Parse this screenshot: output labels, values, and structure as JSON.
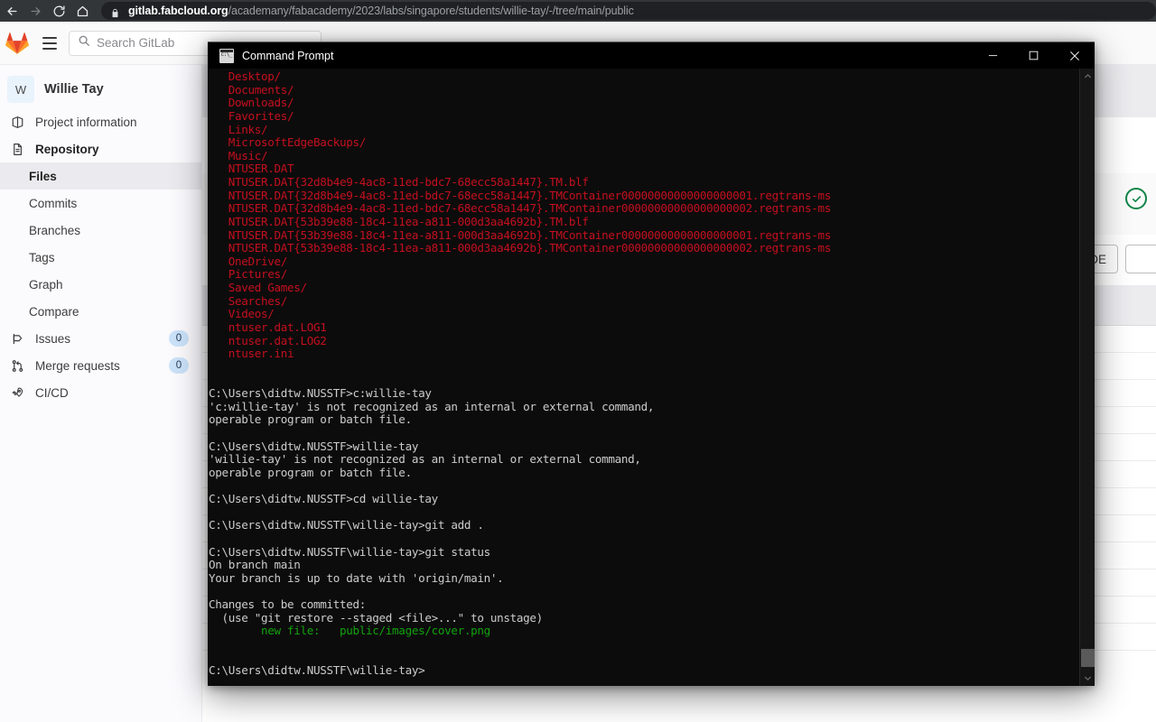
{
  "browser": {
    "back_icon": "arrow-left-icon",
    "forward_icon": "arrow-right-icon",
    "reload_icon": "reload-icon",
    "home_icon": "home-icon",
    "lock_icon": "lock-icon",
    "url_domain": "gitlab.fabcloud.org",
    "url_path": "/academany/fabacademy/2023/labs/singapore/students/willie-tay/-/tree/main/public"
  },
  "topbar": {
    "logo": "gitlab-logo-icon",
    "menu_icon": "hamburger-menu-icon",
    "search_icon": "search-icon",
    "search_placeholder": "Search GitLab",
    "search_value": ""
  },
  "sidebar": {
    "project_initial": "W",
    "project_name": "Willie Tay",
    "items": [
      {
        "label": "Project information",
        "icon": "project-info-icon",
        "badge": ""
      },
      {
        "label": "Repository",
        "icon": "repository-icon",
        "badge": ""
      }
    ],
    "repository_children": [
      {
        "label": "Files",
        "active": true
      },
      {
        "label": "Commits",
        "active": false
      },
      {
        "label": "Branches",
        "active": false
      },
      {
        "label": "Tags",
        "active": false
      },
      {
        "label": "Graph",
        "active": false
      },
      {
        "label": "Compare",
        "active": false
      }
    ],
    "lower_items": [
      {
        "label": "Issues",
        "icon": "issues-icon",
        "badge": "0"
      },
      {
        "label": "Merge requests",
        "icon": "merge-request-icon",
        "badge": "0"
      },
      {
        "label": "CI/CD",
        "icon": "rocket-icon",
        "badge": ""
      }
    ]
  },
  "main": {
    "pipeline_status_icon": "pipeline-success-check-icon",
    "web_ide_label": "Web IDE",
    "file_row_count": 12
  },
  "cmd": {
    "app_icon": "command-prompt-icon",
    "title": "Command Prompt",
    "minimize_icon": "minimize-icon",
    "maximize_icon": "maximize-icon",
    "close_icon": "close-icon",
    "scroll_up_icon": "chevron-up-icon",
    "scroll_down_icon": "chevron-down-icon",
    "lines": [
      {
        "color": "red",
        "text": "   Desktop/"
      },
      {
        "color": "red",
        "text": "   Documents/"
      },
      {
        "color": "red",
        "text": "   Downloads/"
      },
      {
        "color": "red",
        "text": "   Favorites/"
      },
      {
        "color": "red",
        "text": "   Links/"
      },
      {
        "color": "red",
        "text": "   MicrosoftEdgeBackups/"
      },
      {
        "color": "red",
        "text": "   Music/"
      },
      {
        "color": "red",
        "text": "   NTUSER.DAT"
      },
      {
        "color": "red",
        "text": "   NTUSER.DAT{32d8b4e9-4ac8-11ed-bdc7-68ecc58a1447}.TM.blf"
      },
      {
        "color": "red",
        "text": "   NTUSER.DAT{32d8b4e9-4ac8-11ed-bdc7-68ecc58a1447}.TMContainer00000000000000000001.regtrans-ms"
      },
      {
        "color": "red",
        "text": "   NTUSER.DAT{32d8b4e9-4ac8-11ed-bdc7-68ecc58a1447}.TMContainer00000000000000000002.regtrans-ms"
      },
      {
        "color": "red",
        "text": "   NTUSER.DAT{53b39e88-18c4-11ea-a811-000d3aa4692b}.TM.blf"
      },
      {
        "color": "red",
        "text": "   NTUSER.DAT{53b39e88-18c4-11ea-a811-000d3aa4692b}.TMContainer00000000000000000001.regtrans-ms"
      },
      {
        "color": "red",
        "text": "   NTUSER.DAT{53b39e88-18c4-11ea-a811-000d3aa4692b}.TMContainer00000000000000000002.regtrans-ms"
      },
      {
        "color": "red",
        "text": "   OneDrive/"
      },
      {
        "color": "red",
        "text": "   Pictures/"
      },
      {
        "color": "red",
        "text": "   Saved Games/"
      },
      {
        "color": "red",
        "text": "   Searches/"
      },
      {
        "color": "red",
        "text": "   Videos/"
      },
      {
        "color": "red",
        "text": "   ntuser.dat.LOG1"
      },
      {
        "color": "red",
        "text": "   ntuser.dat.LOG2"
      },
      {
        "color": "red",
        "text": "   ntuser.ini"
      },
      {
        "color": "wht",
        "text": ""
      },
      {
        "color": "wht",
        "text": ""
      },
      {
        "color": "wht",
        "text": "C:\\Users\\didtw.NUSSTF>c:willie-tay"
      },
      {
        "color": "wht",
        "text": "'c:willie-tay' is not recognized as an internal or external command,"
      },
      {
        "color": "wht",
        "text": "operable program or batch file."
      },
      {
        "color": "wht",
        "text": ""
      },
      {
        "color": "wht",
        "text": "C:\\Users\\didtw.NUSSTF>willie-tay"
      },
      {
        "color": "wht",
        "text": "'willie-tay' is not recognized as an internal or external command,"
      },
      {
        "color": "wht",
        "text": "operable program or batch file."
      },
      {
        "color": "wht",
        "text": ""
      },
      {
        "color": "wht",
        "text": "C:\\Users\\didtw.NUSSTF>cd willie-tay"
      },
      {
        "color": "wht",
        "text": ""
      },
      {
        "color": "wht",
        "text": "C:\\Users\\didtw.NUSSTF\\willie-tay>git add ."
      },
      {
        "color": "wht",
        "text": ""
      },
      {
        "color": "wht",
        "text": "C:\\Users\\didtw.NUSSTF\\willie-tay>git status"
      },
      {
        "color": "wht",
        "text": "On branch main"
      },
      {
        "color": "wht",
        "text": "Your branch is up to date with 'origin/main'."
      },
      {
        "color": "wht",
        "text": ""
      },
      {
        "color": "wht",
        "text": "Changes to be committed:"
      },
      {
        "color": "wht",
        "text": "  (use \"git restore --staged <file>...\" to unstage)"
      },
      {
        "color": "grn",
        "text": "        new file:   public/images/cover.png"
      },
      {
        "color": "wht",
        "text": ""
      },
      {
        "color": "wht",
        "text": ""
      },
      {
        "color": "wht",
        "text": "C:\\Users\\didtw.NUSSTF\\willie-tay>"
      }
    ]
  }
}
